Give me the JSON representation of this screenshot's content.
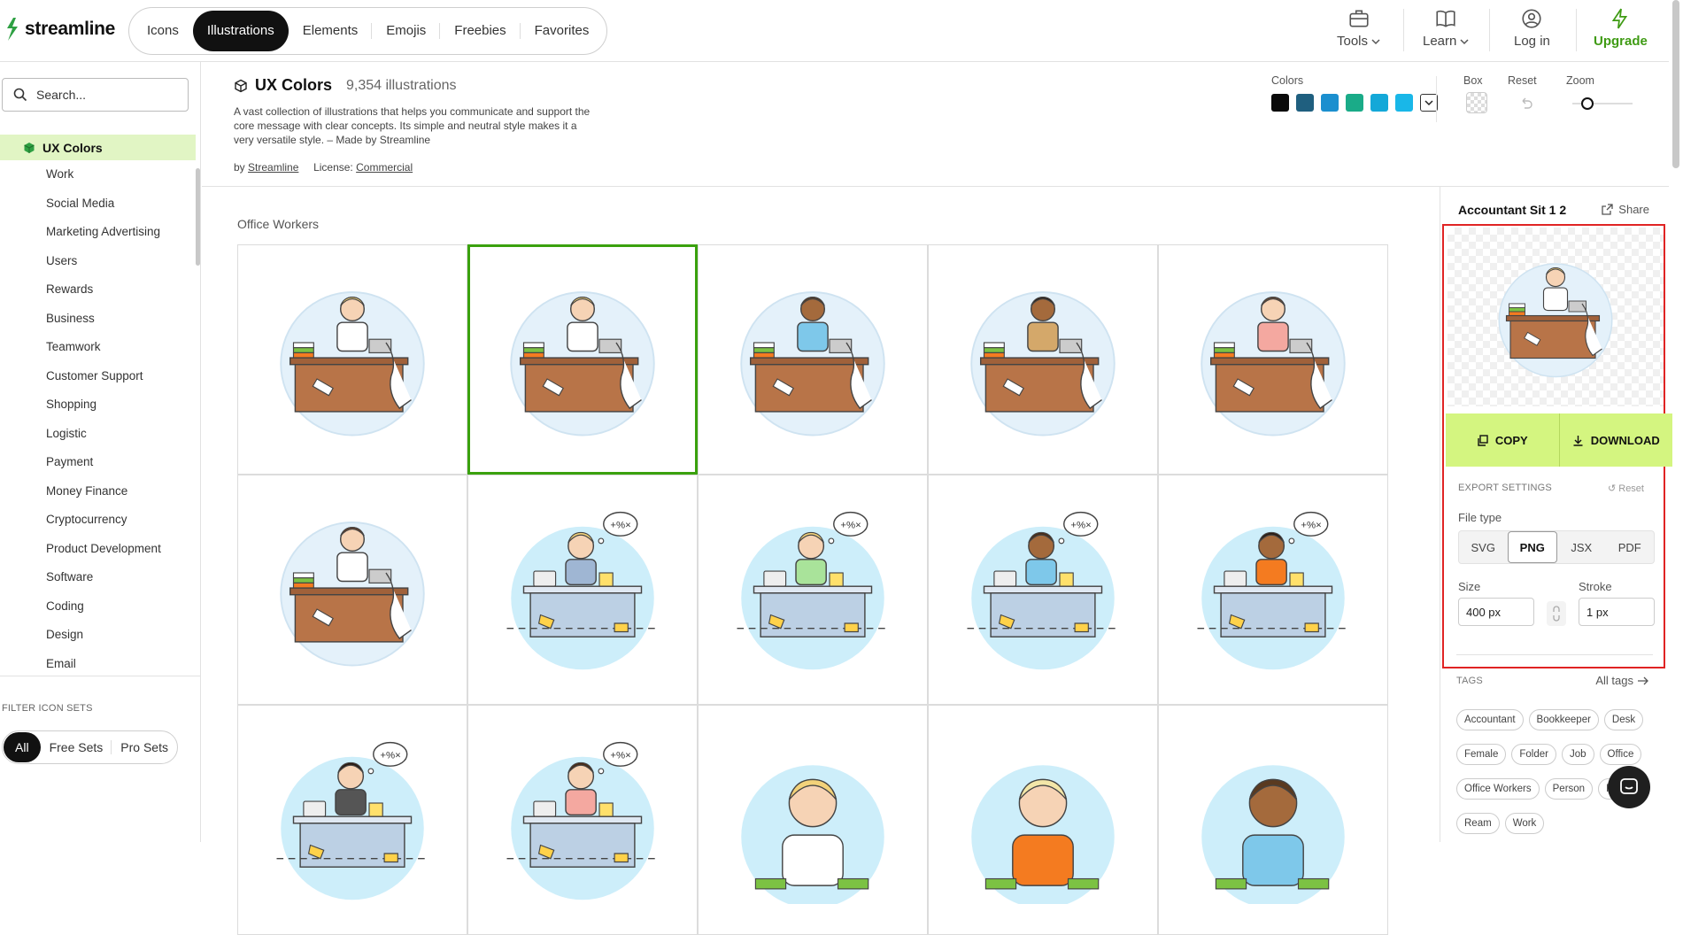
{
  "brand": {
    "name": "streamline",
    "color": "#2ea043"
  },
  "nav": {
    "tabs": [
      {
        "label": "Icons",
        "active": false
      },
      {
        "label": "Illustrations",
        "active": true
      },
      {
        "label": "Elements",
        "active": false
      },
      {
        "label": "Emojis",
        "active": false
      },
      {
        "label": "Freebies",
        "active": false
      },
      {
        "label": "Favorites",
        "active": false
      }
    ],
    "right": {
      "tools": "Tools",
      "learn": "Learn",
      "login": "Log in",
      "upgrade": "Upgrade"
    }
  },
  "sidebar": {
    "search_placeholder": "Search...",
    "selected_set": "UX Colors",
    "categories": [
      "Work",
      "Social Media",
      "Marketing Advertising",
      "Users",
      "Rewards",
      "Business",
      "Teamwork",
      "Customer Support",
      "Shopping",
      "Logistic",
      "Payment",
      "Money Finance",
      "Cryptocurrency",
      "Product Development",
      "Software",
      "Coding",
      "Design",
      "Email"
    ],
    "filter_label": "FILTER ICON SETS",
    "filters": [
      {
        "label": "All",
        "active": true
      },
      {
        "label": "Free Sets",
        "active": false
      },
      {
        "label": "Pro Sets",
        "active": false
      }
    ]
  },
  "set": {
    "title": "UX Colors",
    "count": "9,354 illustrations",
    "description": "A vast collection of illustrations that helps you communicate and support the core message with clear concepts. Its simple and neutral style makes it a very versatile style. – Made by Streamline",
    "by_prefix": "by",
    "author": "Streamline",
    "license_prefix": "License:",
    "license": "Commercial"
  },
  "controls": {
    "colors_label": "Colors",
    "swatches": [
      "#0a0a0a",
      "#1f5f7f",
      "#1b8fcf",
      "#1aab88",
      "#14a8d8",
      "#19b7e8"
    ],
    "box_label": "Box",
    "reset_label": "Reset",
    "zoom_label": "Zoom",
    "zoom_level": 0.25
  },
  "grid": {
    "section_label": "Office Workers",
    "selected_index": 1
  },
  "panel": {
    "title": "Accountant Sit 1 2",
    "share": "Share",
    "copy": "COPY",
    "download": "DOWNLOAD",
    "export_label": "EXPORT SETTINGS",
    "export_reset": "Reset",
    "filetype_label": "File type",
    "filetypes": [
      {
        "label": "SVG",
        "active": false
      },
      {
        "label": "PNG",
        "active": true
      },
      {
        "label": "JSX",
        "active": false
      },
      {
        "label": "PDF",
        "active": false
      }
    ],
    "size_label": "Size",
    "size_value": "400 px",
    "stroke_label": "Stroke",
    "stroke_value": "1 px",
    "tags_label": "TAGS",
    "all_tags": "All tags",
    "tags": [
      "Accountant",
      "Bookkeeper",
      "Desk",
      "Female",
      "Folder",
      "Job",
      "Office",
      "Office Workers",
      "Person",
      "Print",
      "Ream",
      "Work"
    ]
  },
  "accent_green": "#3aa10e",
  "button_green": "#d4f580",
  "highlight_red": "#e02424"
}
